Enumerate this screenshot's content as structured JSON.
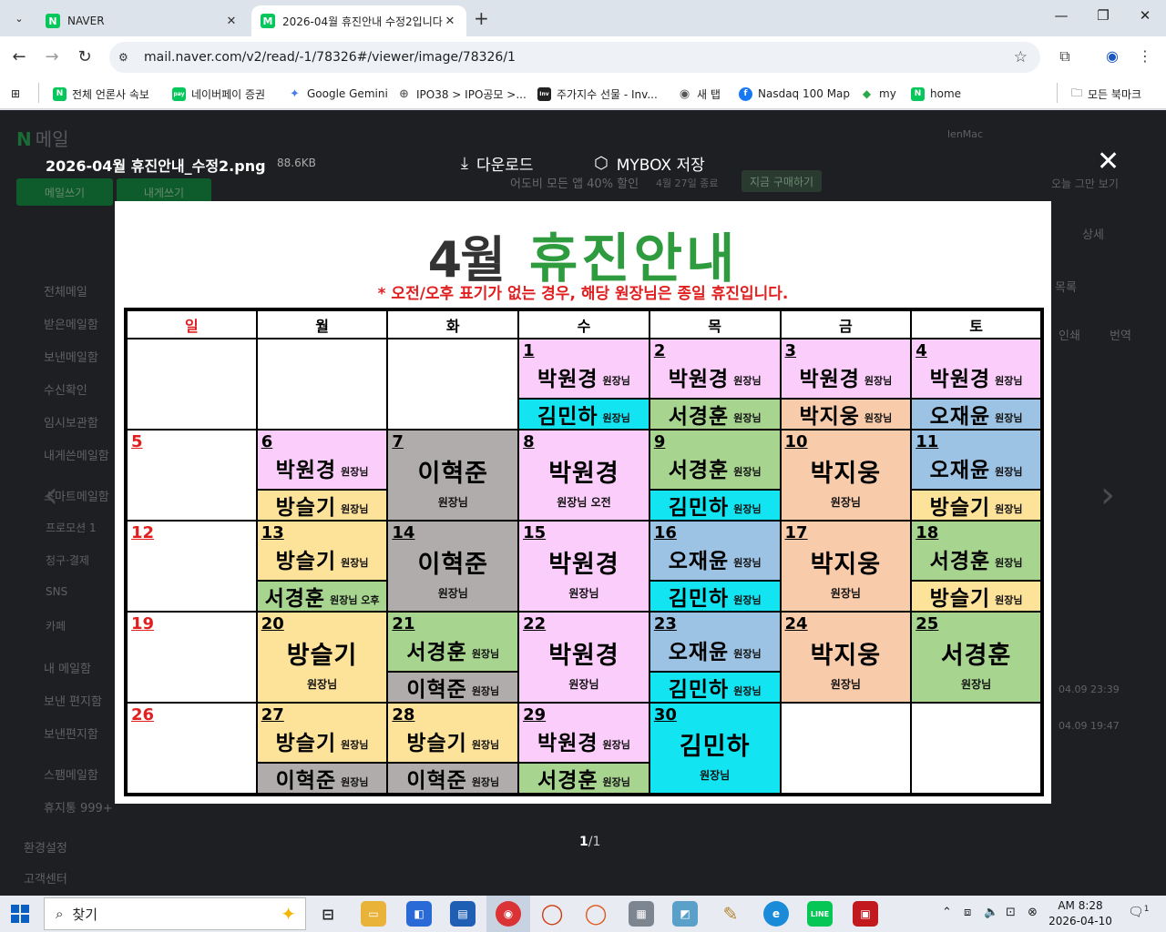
{
  "browser": {
    "tabs": [
      {
        "label": "NAVER",
        "favicon": "N",
        "color": "#03c75a"
      },
      {
        "label": "2026-04월 휴진안내 수정2입니다",
        "favicon": "M",
        "color": "#03c75a"
      }
    ],
    "url": "mail.naver.com/v2/read/-1/78326#/viewer/image/78326/1",
    "bookmarks": [
      {
        "label": "전체 언론사 속보",
        "icon": "N",
        "color": "#03c75a"
      },
      {
        "label": "네이버페이 증권",
        "icon": "pay",
        "color": "#03c75a"
      },
      {
        "label": "Google Gemini",
        "icon": "✦",
        "color": "#4a7cf0"
      },
      {
        "label": "IPO38 > IPO공모 >...",
        "icon": "⊕",
        "color": "#777"
      },
      {
        "label": "주가지수 선물 - Inv...",
        "icon": "Inv",
        "color": "#222"
      },
      {
        "label": "새 탭",
        "icon": "◉",
        "color": "#555"
      },
      {
        "label": "Nasdaq 100 Map",
        "icon": "f",
        "color": "#1877f2"
      },
      {
        "label": "my",
        "icon": "◆",
        "color": "#2aa84a"
      },
      {
        "label": "home",
        "icon": "N",
        "color": "#03c75a"
      }
    ],
    "all_bookmarks": "모든 북마크"
  },
  "mail": {
    "logo": "N",
    "logo_label": "메일",
    "write_button": "메일쓰기",
    "self_button": "내게쓰기",
    "promo": "어도비 모든 앱 40% 할인",
    "promo_date": "4월 27일 종료",
    "promo_cta": "지금 구매하기",
    "ad_dismiss": "오늘 그만 보기",
    "user": "lenMac",
    "detail": "상세",
    "list": "목록",
    "print": "인쇄",
    "translate": "번역",
    "sidebar": [
      "전체메일",
      "받은메일함",
      "보낸메일함",
      "수신확인",
      "임시보관함",
      "내게쓴메일함",
      "스마트메일함",
      "프로모션 1",
      "청구·결제",
      "SNS",
      "카페",
      "내 메일함",
      "보낸 편지함",
      "보낸편지함",
      "스팸메일함",
      "휴지통 999+",
      "환경설정",
      "고객센터"
    ],
    "dates": [
      "04.09 23:39",
      "04.09 19:47"
    ]
  },
  "viewer": {
    "filename": "2026-04월 휴진안내_수정2.png",
    "filesize": "88.6KB",
    "download": "다운로드",
    "mybox": "MYBOX 저장",
    "page_current": "1",
    "page_total": "/1"
  },
  "calendar": {
    "month": "4월",
    "title": "휴진안내",
    "note": "* 오전/오후 표기가 없는 경우, 해당 원장님은 종일 휴진입니다.",
    "weekdays": [
      "일",
      "월",
      "화",
      "수",
      "목",
      "금",
      "토"
    ],
    "rank": "원장님",
    "weeks": [
      [
        {
          "day": "",
          "type": "empty"
        },
        {
          "day": "",
          "type": "empty"
        },
        {
          "day": "",
          "type": "empty"
        },
        {
          "day": "1",
          "type": "split",
          "top": {
            "name": "박원경",
            "color": "pink"
          },
          "bottom": {
            "name": "김민하",
            "color": "cyan"
          }
        },
        {
          "day": "2",
          "type": "split",
          "top": {
            "name": "박원경",
            "color": "pink"
          },
          "bottom": {
            "name": "서경훈",
            "color": "green"
          }
        },
        {
          "day": "3",
          "type": "split",
          "top": {
            "name": "박원경",
            "color": "pink"
          },
          "bottom": {
            "name": "박지웅",
            "color": "peach"
          }
        },
        {
          "day": "4",
          "type": "split",
          "top": {
            "name": "박원경",
            "color": "pink"
          },
          "bottom": {
            "name": "오재윤",
            "color": "blue"
          }
        }
      ],
      [
        {
          "day": "5",
          "type": "empty",
          "red": true
        },
        {
          "day": "6",
          "type": "split",
          "top": {
            "name": "박원경",
            "color": "pink"
          },
          "bottom": {
            "name": "방슬기",
            "color": "yellow"
          }
        },
        {
          "day": "7",
          "type": "full",
          "name": "이혁준",
          "color": "gray"
        },
        {
          "day": "8",
          "type": "full",
          "name": "박원경",
          "color": "pink",
          "note": "원장님 오전"
        },
        {
          "day": "9",
          "type": "split",
          "top": {
            "name": "서경훈",
            "color": "green"
          },
          "bottom": {
            "name": "김민하",
            "color": "cyan"
          }
        },
        {
          "day": "10",
          "type": "full",
          "name": "박지웅",
          "color": "peach"
        },
        {
          "day": "11",
          "type": "split",
          "top": {
            "name": "오재윤",
            "color": "blue"
          },
          "bottom": {
            "name": "방슬기",
            "color": "yellow"
          }
        }
      ],
      [
        {
          "day": "12",
          "type": "empty",
          "red": true
        },
        {
          "day": "13",
          "type": "split",
          "top": {
            "name": "방슬기",
            "color": "yellow"
          },
          "bottom": {
            "name": "서경훈",
            "color": "green",
            "note": "원장님 오후"
          }
        },
        {
          "day": "14",
          "type": "full",
          "name": "이혁준",
          "color": "gray"
        },
        {
          "day": "15",
          "type": "full",
          "name": "박원경",
          "color": "pink"
        },
        {
          "day": "16",
          "type": "split",
          "top": {
            "name": "오재윤",
            "color": "blue"
          },
          "bottom": {
            "name": "김민하",
            "color": "cyan"
          }
        },
        {
          "day": "17",
          "type": "full",
          "name": "박지웅",
          "color": "peach"
        },
        {
          "day": "18",
          "type": "split",
          "top": {
            "name": "서경훈",
            "color": "green"
          },
          "bottom": {
            "name": "방슬기",
            "color": "yellow"
          }
        }
      ],
      [
        {
          "day": "19",
          "type": "empty",
          "red": true
        },
        {
          "day": "20",
          "type": "full",
          "name": "방슬기",
          "color": "yellow"
        },
        {
          "day": "21",
          "type": "split",
          "top": {
            "name": "서경훈",
            "color": "green"
          },
          "bottom": {
            "name": "이혁준",
            "color": "gray"
          }
        },
        {
          "day": "22",
          "type": "full",
          "name": "박원경",
          "color": "pink"
        },
        {
          "day": "23",
          "type": "split",
          "top": {
            "name": "오재윤",
            "color": "blue"
          },
          "bottom": {
            "name": "김민하",
            "color": "cyan"
          }
        },
        {
          "day": "24",
          "type": "full",
          "name": "박지웅",
          "color": "peach"
        },
        {
          "day": "25",
          "type": "full",
          "name": "서경훈",
          "color": "green"
        }
      ],
      [
        {
          "day": "26",
          "type": "empty",
          "red": true
        },
        {
          "day": "27",
          "type": "split",
          "top": {
            "name": "방슬기",
            "color": "yellow"
          },
          "bottom": {
            "name": "이혁준",
            "color": "gray"
          }
        },
        {
          "day": "28",
          "type": "split",
          "top": {
            "name": "방슬기",
            "color": "yellow"
          },
          "bottom": {
            "name": "이혁준",
            "color": "gray"
          }
        },
        {
          "day": "29",
          "type": "split",
          "top": {
            "name": "박원경",
            "color": "pink"
          },
          "bottom": {
            "name": "서경훈",
            "color": "green"
          }
        },
        {
          "day": "30",
          "type": "full",
          "name": "김민하",
          "color": "cyan"
        },
        {
          "day": "",
          "type": "empty"
        },
        {
          "day": "",
          "type": "empty"
        }
      ]
    ]
  },
  "taskbar": {
    "search": "찾기",
    "time": "AM 8:28",
    "date": "2026-04-10",
    "notifications": "1"
  }
}
